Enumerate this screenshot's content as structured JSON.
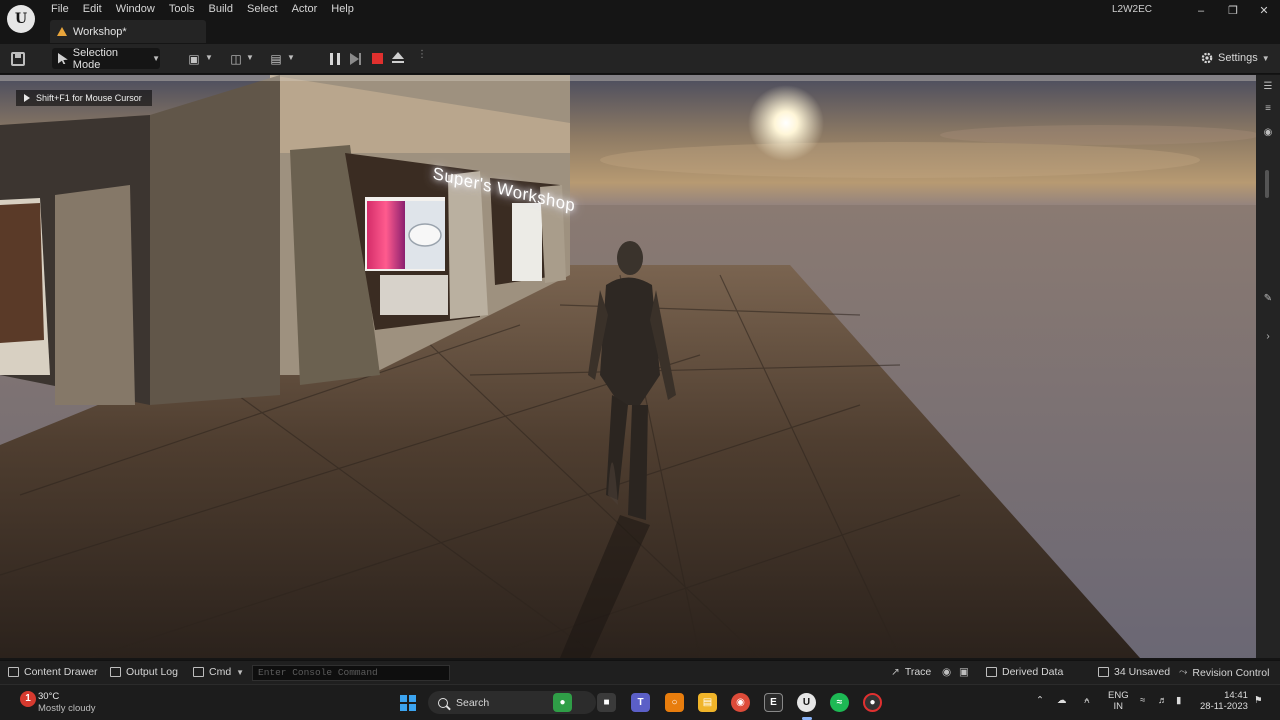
{
  "app": {
    "project_name": "L2W2EC",
    "level_tab": "Workshop*",
    "menu": [
      "File",
      "Edit",
      "Window",
      "Tools",
      "Build",
      "Select",
      "Actor",
      "Help"
    ]
  },
  "toolbar": {
    "mode_label": "Selection Mode",
    "settings_label": "Settings"
  },
  "viewport": {
    "mouse_hint": "Shift+F1 for Mouse Cursor",
    "sign_text": "Super's Workshop"
  },
  "statusbar": {
    "content_drawer": "Content Drawer",
    "output_log": "Output Log",
    "cmd_label": "Cmd",
    "console_placeholder": "Enter Console Command",
    "trace": "Trace",
    "derived_data": "Derived Data",
    "unsaved": "34 Unsaved",
    "revision_control": "Revision Control"
  },
  "taskbar": {
    "weather_temp": "30°C",
    "weather_condition": "Mostly cloudy",
    "weather_badge": "1",
    "search_label": "Search",
    "lang_top": "ENG",
    "lang_bottom": "IN",
    "time": "14:41",
    "date": "28-11-2023"
  },
  "colors": {
    "editor_bg": "#151515",
    "toolbar_bg": "#242424",
    "stop_red": "#e0302e",
    "level_tab_icon": "#e9a53b",
    "windows_blue": "#3ca4f0"
  }
}
